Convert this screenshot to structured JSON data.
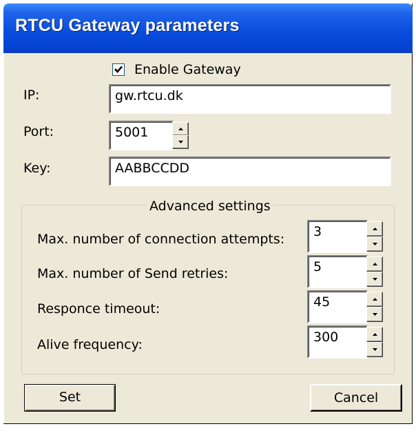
{
  "window": {
    "title": "RTCU Gateway parameters"
  },
  "gateway": {
    "enable_label": "Enable Gateway",
    "enabled": true,
    "ip_label": "IP:",
    "ip_value": "gw.rtcu.dk",
    "port_label": "Port:",
    "port_value": "5001",
    "key_label": "Key:",
    "key_value": "AABBCCDD"
  },
  "advanced": {
    "title": "Advanced settings",
    "connection_attempts_label": "Max. number of connection attempts:",
    "connection_attempts_value": "3",
    "send_retries_label": "Max. number of Send retries:",
    "send_retries_value": "5",
    "response_timeout_label": "Responce timeout:",
    "response_timeout_value": "45",
    "alive_frequency_label": "Alive frequency:",
    "alive_frequency_value": "300"
  },
  "buttons": {
    "set_label": "Set",
    "cancel_label": "Cancel"
  }
}
